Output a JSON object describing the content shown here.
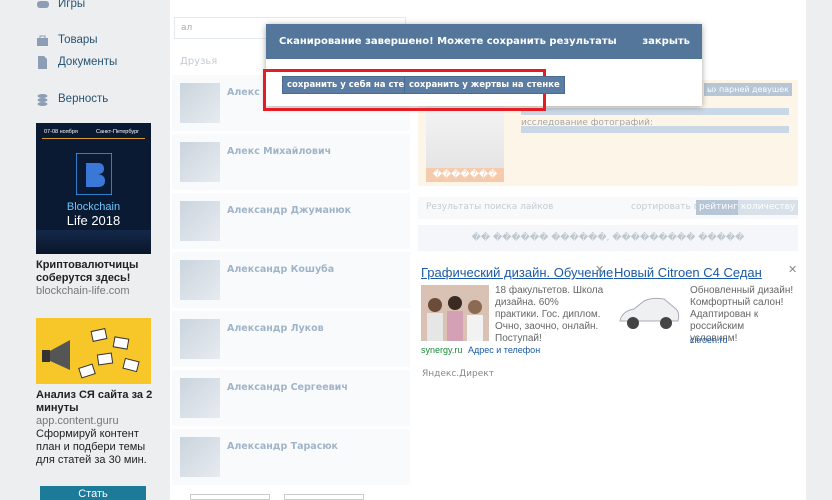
{
  "leftnav": {
    "games": {
      "label": "Игры",
      "badge": "1"
    },
    "goods": {
      "label": "Товары"
    },
    "docs": {
      "label": "Документы"
    },
    "loyalty": {
      "label": "Верность"
    }
  },
  "ads_left": {
    "blockchain": {
      "date": "07-08 ноября",
      "city": "Санкт-Петербург",
      "brand1": "Blockchain",
      "brand2": "Life 2018",
      "title": "Криптовалютчицы соберутся здесь!",
      "domain": "blockchain-life.com"
    },
    "content": {
      "title": "Анализ СЯ сайта за 2 минуты",
      "domain": "app.content.guru",
      "desc": "Сформируй контент план и подбери темы для статей за 30 мин."
    },
    "stat_button": "Стать"
  },
  "search": {
    "value": "ал"
  },
  "friends_section": "Друзья",
  "friends": [
    "Алекс К",
    "Алекс Михайлович",
    "Александр Джуманюк",
    "Александр Кошуба",
    "Александр Луков",
    "Александр Сергеевич",
    "Александр Тарасюк"
  ],
  "right_panel": {
    "caption": "�������",
    "photo_research": "исследование фотографий:",
    "tags": [
      "ых",
      "парней",
      "девушек"
    ]
  },
  "likes": {
    "title": "Результаты поиска лайков",
    "sort_label": "сортировать по",
    "sort_rating": "рейтингу",
    "sort_count": "количеству"
  },
  "dots_bar": "�� ������ ������, ��������� �����",
  "yad": [
    {
      "title": "Графический дизайн. Обучение",
      "text": "18 факультетов. Школа дизайна. 60% практики. Гос. диплом. Очно, заочно, онлайн. Поступай!",
      "source": "synergy.ru",
      "extra": "Адрес и телефон"
    },
    {
      "title": "Новый Citroen C4 Седан",
      "text": "Обновленный дизайн! Комфортный салон! Адаптирован к российским условиям!",
      "source": "citroen.ru"
    }
  ],
  "ydirect": "Яндекс.Директ",
  "modal": {
    "title": "Сканирование завершено! Можете сохранить результаты",
    "close": "закрыть",
    "btn_self": "сохранить у себя на стенке",
    "btn_victim": "сохранить у жертвы на стенке"
  },
  "colors": {
    "modal_header": "#54769a",
    "highlight": "#e51c23",
    "button": "#5b7da3"
  }
}
